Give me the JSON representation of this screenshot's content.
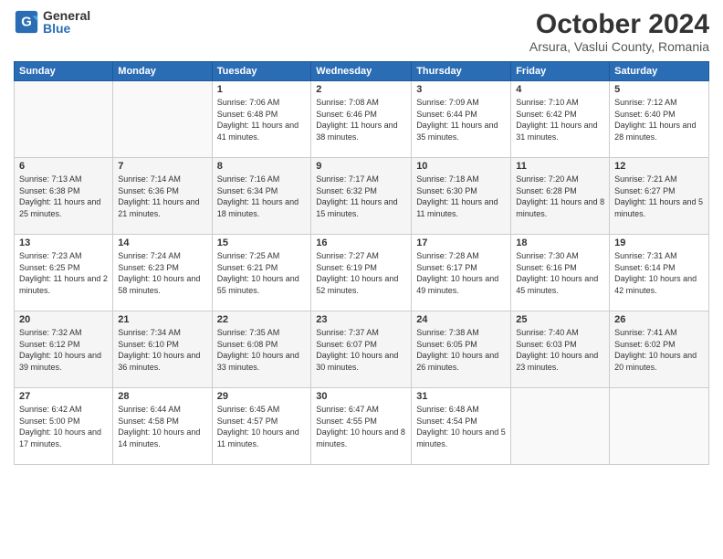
{
  "logo": {
    "general": "General",
    "blue": "Blue"
  },
  "header": {
    "month": "October 2024",
    "location": "Arsura, Vaslui County, Romania"
  },
  "weekdays": [
    "Sunday",
    "Monday",
    "Tuesday",
    "Wednesday",
    "Thursday",
    "Friday",
    "Saturday"
  ],
  "weeks": [
    [
      {
        "day": "",
        "info": ""
      },
      {
        "day": "",
        "info": ""
      },
      {
        "day": "1",
        "info": "Sunrise: 7:06 AM\nSunset: 6:48 PM\nDaylight: 11 hours and 41 minutes."
      },
      {
        "day": "2",
        "info": "Sunrise: 7:08 AM\nSunset: 6:46 PM\nDaylight: 11 hours and 38 minutes."
      },
      {
        "day": "3",
        "info": "Sunrise: 7:09 AM\nSunset: 6:44 PM\nDaylight: 11 hours and 35 minutes."
      },
      {
        "day": "4",
        "info": "Sunrise: 7:10 AM\nSunset: 6:42 PM\nDaylight: 11 hours and 31 minutes."
      },
      {
        "day": "5",
        "info": "Sunrise: 7:12 AM\nSunset: 6:40 PM\nDaylight: 11 hours and 28 minutes."
      }
    ],
    [
      {
        "day": "6",
        "info": "Sunrise: 7:13 AM\nSunset: 6:38 PM\nDaylight: 11 hours and 25 minutes."
      },
      {
        "day": "7",
        "info": "Sunrise: 7:14 AM\nSunset: 6:36 PM\nDaylight: 11 hours and 21 minutes."
      },
      {
        "day": "8",
        "info": "Sunrise: 7:16 AM\nSunset: 6:34 PM\nDaylight: 11 hours and 18 minutes."
      },
      {
        "day": "9",
        "info": "Sunrise: 7:17 AM\nSunset: 6:32 PM\nDaylight: 11 hours and 15 minutes."
      },
      {
        "day": "10",
        "info": "Sunrise: 7:18 AM\nSunset: 6:30 PM\nDaylight: 11 hours and 11 minutes."
      },
      {
        "day": "11",
        "info": "Sunrise: 7:20 AM\nSunset: 6:28 PM\nDaylight: 11 hours and 8 minutes."
      },
      {
        "day": "12",
        "info": "Sunrise: 7:21 AM\nSunset: 6:27 PM\nDaylight: 11 hours and 5 minutes."
      }
    ],
    [
      {
        "day": "13",
        "info": "Sunrise: 7:23 AM\nSunset: 6:25 PM\nDaylight: 11 hours and 2 minutes."
      },
      {
        "day": "14",
        "info": "Sunrise: 7:24 AM\nSunset: 6:23 PM\nDaylight: 10 hours and 58 minutes."
      },
      {
        "day": "15",
        "info": "Sunrise: 7:25 AM\nSunset: 6:21 PM\nDaylight: 10 hours and 55 minutes."
      },
      {
        "day": "16",
        "info": "Sunrise: 7:27 AM\nSunset: 6:19 PM\nDaylight: 10 hours and 52 minutes."
      },
      {
        "day": "17",
        "info": "Sunrise: 7:28 AM\nSunset: 6:17 PM\nDaylight: 10 hours and 49 minutes."
      },
      {
        "day": "18",
        "info": "Sunrise: 7:30 AM\nSunset: 6:16 PM\nDaylight: 10 hours and 45 minutes."
      },
      {
        "day": "19",
        "info": "Sunrise: 7:31 AM\nSunset: 6:14 PM\nDaylight: 10 hours and 42 minutes."
      }
    ],
    [
      {
        "day": "20",
        "info": "Sunrise: 7:32 AM\nSunset: 6:12 PM\nDaylight: 10 hours and 39 minutes."
      },
      {
        "day": "21",
        "info": "Sunrise: 7:34 AM\nSunset: 6:10 PM\nDaylight: 10 hours and 36 minutes."
      },
      {
        "day": "22",
        "info": "Sunrise: 7:35 AM\nSunset: 6:08 PM\nDaylight: 10 hours and 33 minutes."
      },
      {
        "day": "23",
        "info": "Sunrise: 7:37 AM\nSunset: 6:07 PM\nDaylight: 10 hours and 30 minutes."
      },
      {
        "day": "24",
        "info": "Sunrise: 7:38 AM\nSunset: 6:05 PM\nDaylight: 10 hours and 26 minutes."
      },
      {
        "day": "25",
        "info": "Sunrise: 7:40 AM\nSunset: 6:03 PM\nDaylight: 10 hours and 23 minutes."
      },
      {
        "day": "26",
        "info": "Sunrise: 7:41 AM\nSunset: 6:02 PM\nDaylight: 10 hours and 20 minutes."
      }
    ],
    [
      {
        "day": "27",
        "info": "Sunrise: 6:42 AM\nSunset: 5:00 PM\nDaylight: 10 hours and 17 minutes."
      },
      {
        "day": "28",
        "info": "Sunrise: 6:44 AM\nSunset: 4:58 PM\nDaylight: 10 hours and 14 minutes."
      },
      {
        "day": "29",
        "info": "Sunrise: 6:45 AM\nSunset: 4:57 PM\nDaylight: 10 hours and 11 minutes."
      },
      {
        "day": "30",
        "info": "Sunrise: 6:47 AM\nSunset: 4:55 PM\nDaylight: 10 hours and 8 minutes."
      },
      {
        "day": "31",
        "info": "Sunrise: 6:48 AM\nSunset: 4:54 PM\nDaylight: 10 hours and 5 minutes."
      },
      {
        "day": "",
        "info": ""
      },
      {
        "day": "",
        "info": ""
      }
    ]
  ]
}
